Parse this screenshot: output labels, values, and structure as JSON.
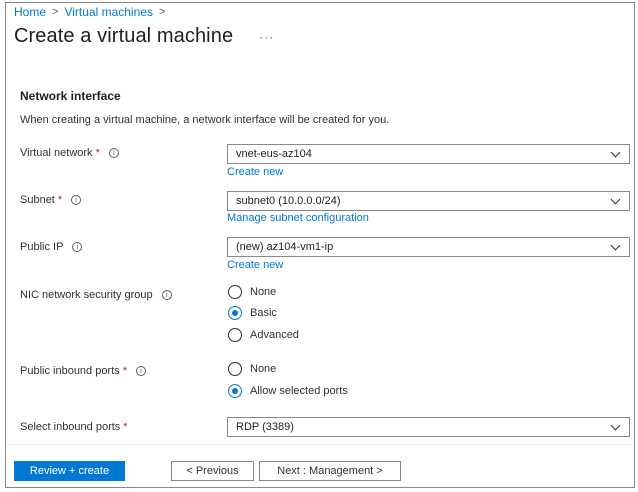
{
  "breadcrumb": {
    "home": "Home",
    "sep1": ">",
    "vms": "Virtual machines",
    "sep2": ">"
  },
  "page": {
    "title": "Create a virtual machine",
    "more": "···"
  },
  "section": {
    "title": "Network interface",
    "description": "When creating a virtual machine, a network interface will be created for you."
  },
  "fields": {
    "vnet": {
      "label": "Virtual network",
      "required": "*",
      "value": "vnet-eus-az104",
      "link": "Create new"
    },
    "subnet": {
      "label": "Subnet",
      "required": "*",
      "value": "subnet0 (10.0.0.0/24)",
      "link": "Manage subnet configuration"
    },
    "public_ip": {
      "label": "Public IP",
      "value": "(new) az104-vm1-ip",
      "link": "Create new"
    },
    "nsg": {
      "label": "NIC network security group",
      "options": [
        "None",
        "Basic",
        "Advanced"
      ],
      "selected": "Basic"
    },
    "inbound": {
      "label": "Public inbound ports",
      "required": "*",
      "options": [
        "None",
        "Allow selected ports"
      ],
      "selected": "Allow selected ports"
    },
    "select_ports": {
      "label": "Select inbound ports",
      "required": "*",
      "value": "RDP (3389)"
    }
  },
  "info_glyph": "i",
  "footer": {
    "review": "Review + create",
    "previous": "< Previous",
    "next": "Next : Management >"
  },
  "colors": {
    "accent": "#0078d4",
    "required": "#a4262c",
    "border": "#8a8886"
  }
}
